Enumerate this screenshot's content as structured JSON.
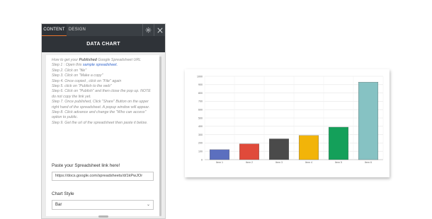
{
  "tabs": [
    {
      "label": "CONTENT",
      "active": true
    },
    {
      "label": "DESIGN",
      "active": false
    }
  ],
  "icons": {
    "settings": "gear-icon",
    "close": "close-icon"
  },
  "panel": {
    "title": "DATA CHART",
    "instructions": {
      "intro_prefix": "How to get your ",
      "intro_bold": "Published",
      "intro_suffix": " Google Spreadsheet URL",
      "step1_prefix": "Step 1 : Open this ",
      "step1_link": "sample spreadsheet.",
      "steps": [
        "Step 2. Click on \"file\"",
        "Step 3. Click on \"Make a copy\"",
        "Step 4. Once copied , click on \"File\" again",
        "Step 5. click on \"Publish to the web\"",
        "Step 6. Click on \"Publish\" and then close the pop up. NOTE do not copy the link yet.",
        "Step 7. Once published, Click \"Share\" Button on the upper right hand of the spreadsheet. A popup window will appear.",
        "Step 8. Click advance and change the \"Who can access\" option to public.",
        "Step 9. Get the url of the spreadsheet then paste it below."
      ]
    },
    "spreadsheet_label": "Paste your Spreadsheet link here!",
    "spreadsheet_value": "https://docs.google.com/spreadsheets/d/1kPwJOr",
    "chart_style_label": "Chart Style",
    "chart_style_value": "Bar"
  },
  "colors": {
    "accent": "#e8742c",
    "panel_dark": "#2f3338"
  },
  "chart_data": {
    "type": "bar",
    "categories": [
      "Item 1",
      "Item 2",
      "Item 3",
      "Item 4",
      "Item 5",
      "Item 6"
    ],
    "values": [
      120,
      190,
      250,
      290,
      390,
      930
    ],
    "colors": [
      "#5b6fbf",
      "#e04a3a",
      "#4a4a4a",
      "#f2b409",
      "#14a05a",
      "#86c2c3"
    ],
    "ylim": [
      0,
      1000
    ],
    "yticks": [
      0,
      100,
      200,
      300,
      400,
      500,
      600,
      700,
      800,
      900,
      1000
    ],
    "grid": true
  }
}
